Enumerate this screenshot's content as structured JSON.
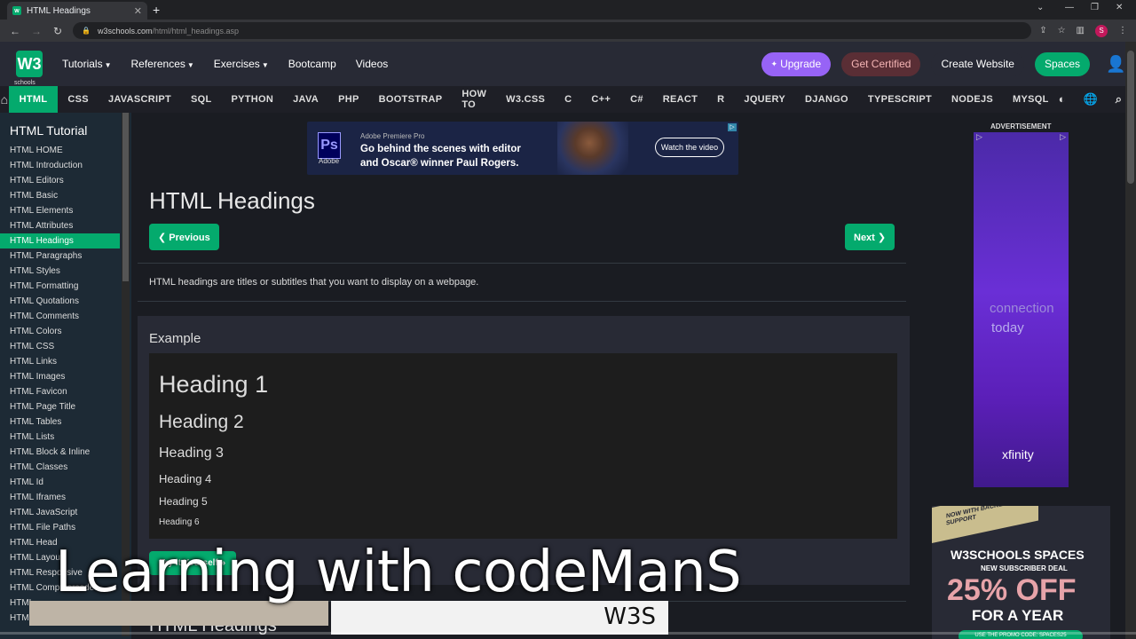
{
  "browser": {
    "tab_title": "HTML Headings",
    "new_tab": "+",
    "url_domain": "w3schools.com",
    "url_path": "/html/html_headings.asp",
    "profile_letter": "S"
  },
  "topnav": {
    "logo": "W3",
    "logo_sub": "schools",
    "menu": [
      "Tutorials",
      "References",
      "Exercises",
      "Bootcamp",
      "Videos"
    ],
    "upgrade": "Upgrade",
    "get_certified": "Get Certified",
    "create_website": "Create Website",
    "spaces": "Spaces"
  },
  "langbar": [
    "HTML",
    "CSS",
    "JAVASCRIPT",
    "SQL",
    "PYTHON",
    "JAVA",
    "PHP",
    "BOOTSTRAP",
    "HOW TO",
    "W3.CSS",
    "C",
    "C++",
    "C#",
    "REACT",
    "R",
    "JQUERY",
    "DJANGO",
    "TYPESCRIPT",
    "NODEJS",
    "MYSQL"
  ],
  "sidebar": {
    "title": "HTML Tutorial",
    "items": [
      "HTML HOME",
      "HTML Introduction",
      "HTML Editors",
      "HTML Basic",
      "HTML Elements",
      "HTML Attributes",
      "HTML Headings",
      "HTML Paragraphs",
      "HTML Styles",
      "HTML Formatting",
      "HTML Quotations",
      "HTML Comments",
      "HTML Colors",
      "HTML CSS",
      "HTML Links",
      "HTML Images",
      "HTML Favicon",
      "HTML Page Title",
      "HTML Tables",
      "HTML Lists",
      "HTML Block & Inline",
      "HTML Classes",
      "HTML Id",
      "HTML Iframes",
      "HTML JavaScript",
      "HTML File Paths",
      "HTML Head",
      "HTML Layout",
      "HTML Responsive",
      "HTML Computercode",
      "HTML",
      "HTML"
    ],
    "active_index": 6
  },
  "ad_top": {
    "logo": "Ps",
    "logo_text": "Adobe",
    "small": "Adobe Premiere Pro",
    "line1": "Go behind the scenes with editor",
    "line2": "and Oscar® winner Paul Rogers.",
    "button": "Watch the video"
  },
  "main": {
    "title": "HTML Headings",
    "prev": "❮ Previous",
    "next": "Next ❯",
    "intro": "HTML headings are titles or subtitles that you want to display on a webpage.",
    "example_label": "Example",
    "headings": [
      "Heading 1",
      "Heading 2",
      "Heading 3",
      "Heading 4",
      "Heading 5",
      "Heading 6"
    ],
    "try_it": "Try it Yourself »",
    "next_section": "HTML Headings"
  },
  "right_ads": {
    "advertisement": "ADVERTISEMENT",
    "xfinity_line1": "connection",
    "xfinity_line2": "today",
    "xfinity_brand": "xfinity",
    "ribbon": "NOW WITH BACKEND SUPPORT",
    "spaces_title": "W3SCHOOLS SPACES",
    "spaces_deal": "NEW SUBSCRIBER DEAL",
    "spaces_off": "25% OFF",
    "spaces_year": "FOR A YEAR",
    "promo": "USE THE PROMO CODE: SPACES25"
  },
  "overlay": {
    "caption": "Learning with codeManS",
    "caption_tag": "W3S"
  },
  "colors": {
    "accent": "#04aa6d",
    "upgrade": "#9763f6",
    "page_bg": "#1d2a35"
  }
}
